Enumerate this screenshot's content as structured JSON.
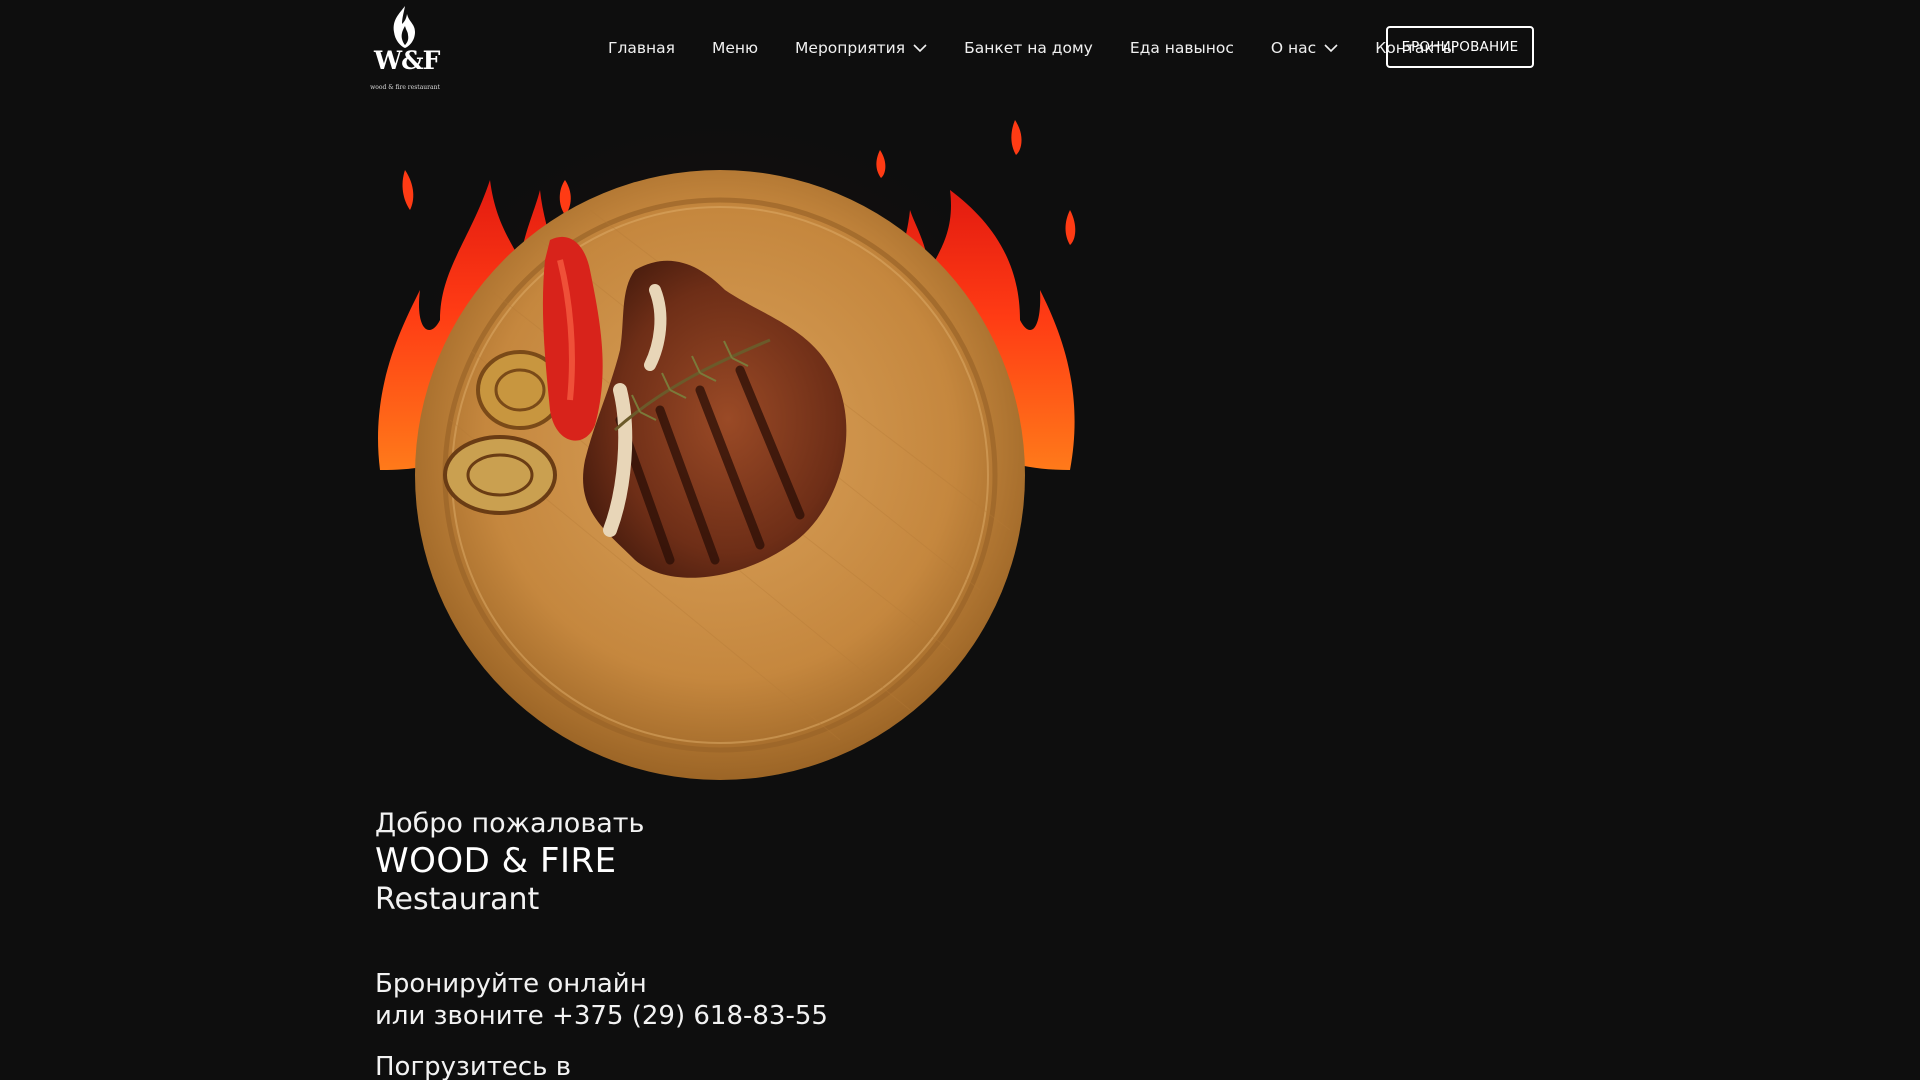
{
  "header": {
    "logo": {
      "mark": "W&F",
      "subtitle": "wood & fire restaurant",
      "icon": "flame-icon"
    },
    "nav": [
      {
        "label": "Главная",
        "has_dropdown": false
      },
      {
        "label": "Меню",
        "has_dropdown": false
      },
      {
        "label": "Мероприятия",
        "has_dropdown": true
      },
      {
        "label": "Банкет на дому",
        "has_dropdown": false
      },
      {
        "label": "Еда навынос",
        "has_dropdown": false
      },
      {
        "label": "О нас",
        "has_dropdown": true
      },
      {
        "label": "Контакты",
        "has_dropdown": false
      }
    ],
    "booking_button": "БРОНИРОВАНИЕ"
  },
  "hero": {
    "image": "steak-on-wooden-board-with-flames",
    "colors": {
      "background": "#0e0e0e",
      "board": "#c58a3f",
      "flame": "#ff4a12"
    }
  },
  "welcome": {
    "line1": "Добро пожаловать",
    "line2": "WOOD & FIRE",
    "line3": "Restaurant"
  },
  "booking": {
    "line1": "Бронируйте онлайн",
    "line2_prefix": "или звоните ",
    "phone": "+375 (29) 618-83-55"
  },
  "immerse": {
    "line1": "Погрузитесь в"
  }
}
